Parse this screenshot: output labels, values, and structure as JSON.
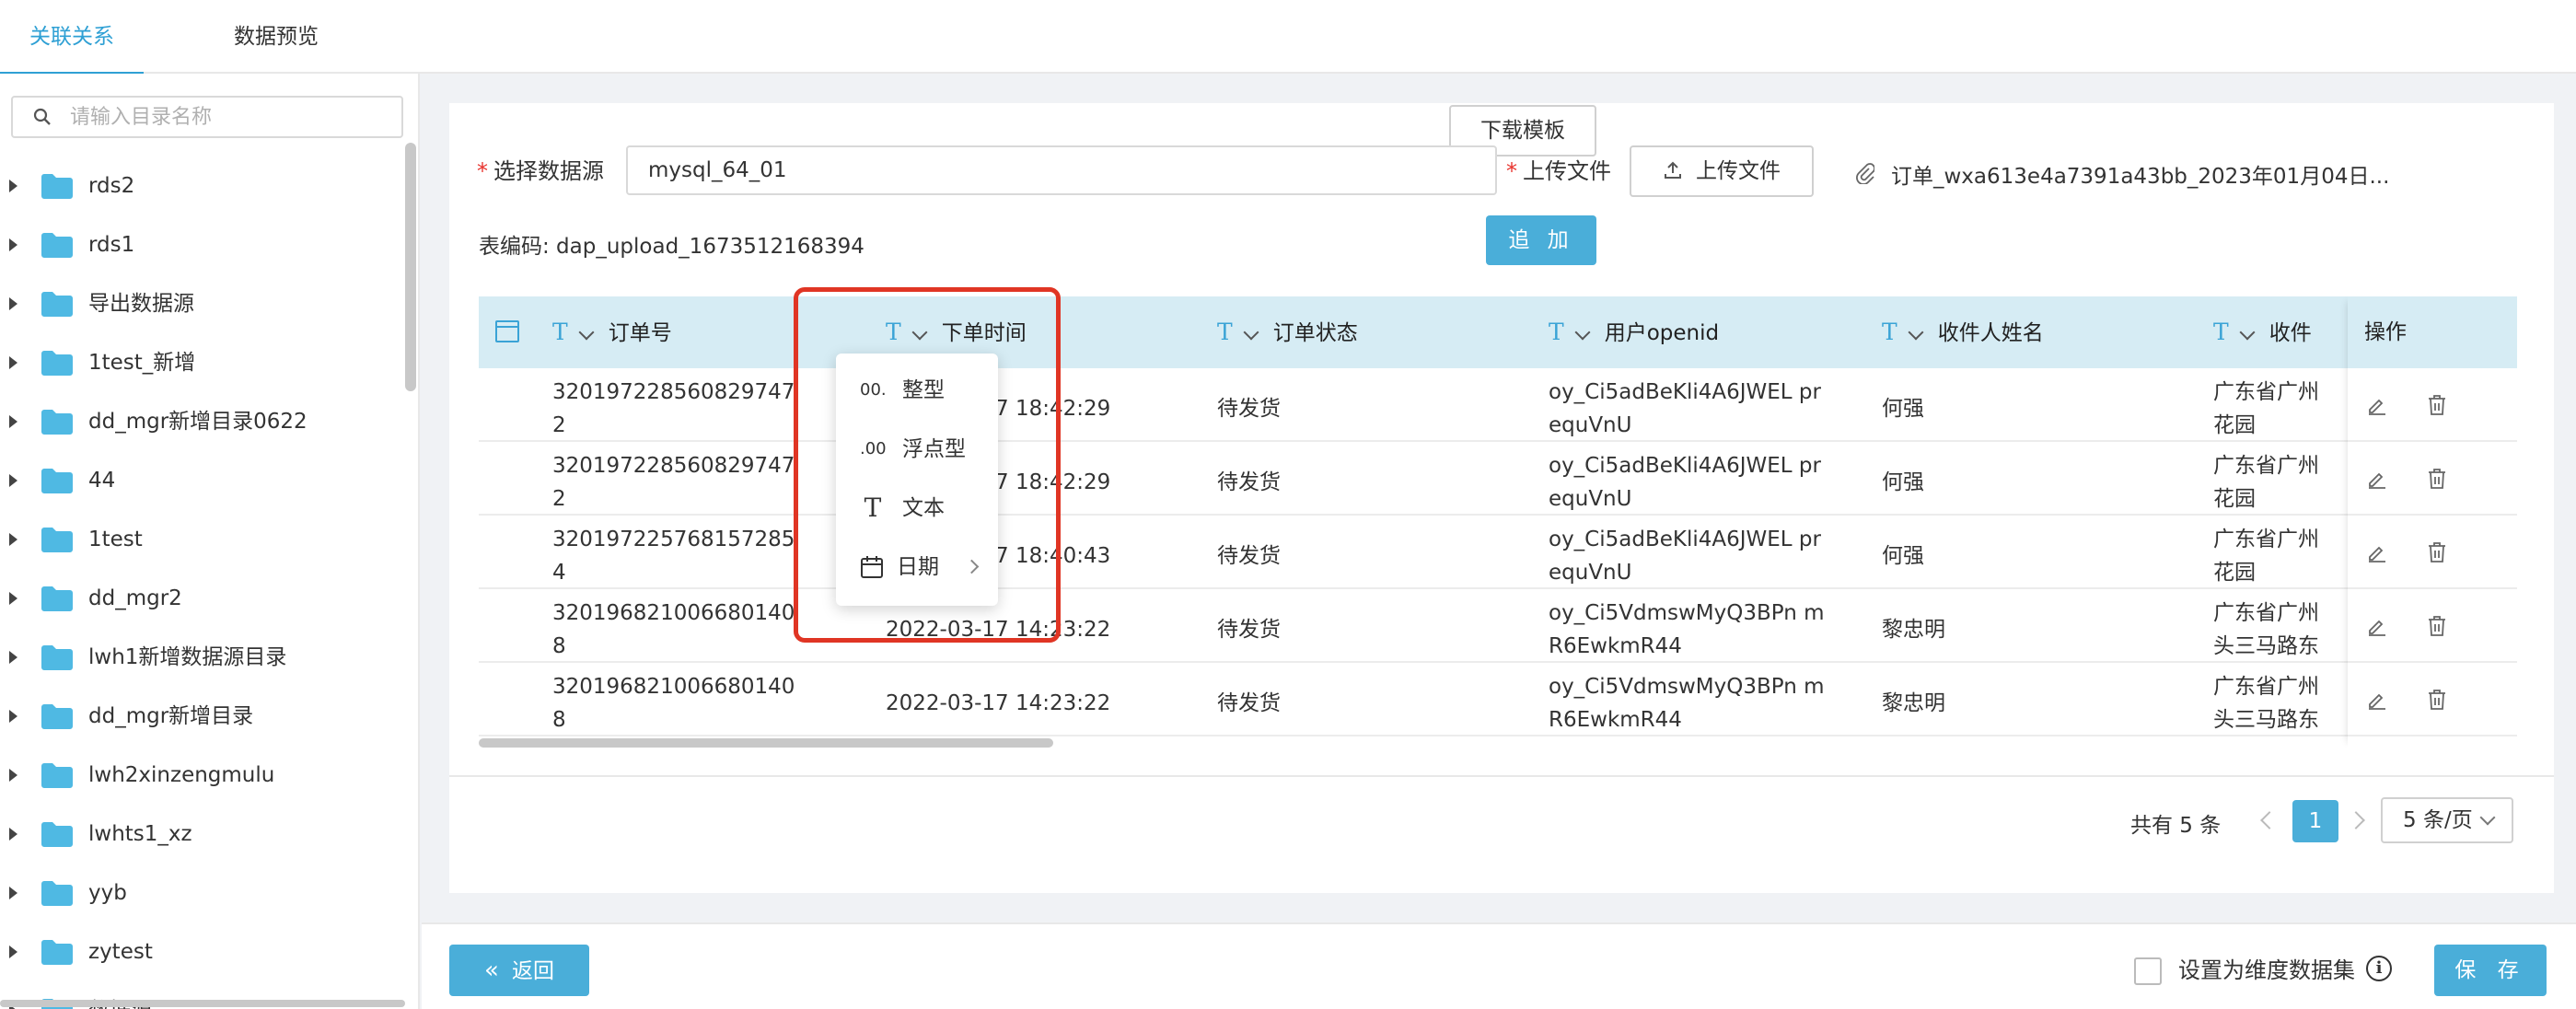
{
  "tabs": [
    {
      "label": "关联关系",
      "active": true
    },
    {
      "label": "数据预览",
      "active": false
    }
  ],
  "sidebar": {
    "search_placeholder": "请输入目录名称",
    "items": [
      {
        "label": "rds2"
      },
      {
        "label": "rds1"
      },
      {
        "label": "导出数据源"
      },
      {
        "label": "1test_新增"
      },
      {
        "label": "dd_mgr新增目录0622"
      },
      {
        "label": "44"
      },
      {
        "label": "1test"
      },
      {
        "label": "dd_mgr2"
      },
      {
        "label": "lwh1新增数据源目录"
      },
      {
        "label": "dd_mgr新增目录"
      },
      {
        "label": "lwh2xinzengmulu"
      },
      {
        "label": "lwhts1_xz"
      },
      {
        "label": "yyb"
      },
      {
        "label": "zytest"
      },
      {
        "label": "数据源"
      }
    ]
  },
  "form": {
    "download_template": "下载模板",
    "datasource_label": "选择数据源",
    "datasource_value": "mysql_64_01",
    "upload_label": "上传文件",
    "upload_button": "上传文件",
    "file_name": "订单_wxa613e4a7391a43bb_2023年01月04日...",
    "add_button": "追 加",
    "table_code": "表编码: dap_upload_1673512168394"
  },
  "table": {
    "type_icon": "T",
    "columns": [
      "订单号",
      "下单时间",
      "订单状态",
      "用户openid",
      "收件人姓名",
      "收件"
    ],
    "ops_header": "操作",
    "rows": [
      [
        "320197228560829747 2",
        "2022-03-17 18:42:29",
        "待发货",
        "oy_Ci5adBeKli4A6JWEL prequVnU",
        "何强",
        "广东省广州 花园"
      ],
      [
        "320197228560829747 2",
        "2022-03-17 18:42:29",
        "待发货",
        "oy_Ci5adBeKli4A6JWEL prequVnU",
        "何强",
        "广东省广州 花园"
      ],
      [
        "320197225768157285 4",
        "2022-03-17 18:40:43",
        "待发货",
        "oy_Ci5adBeKli4A6JWEL prequVnU",
        "何强",
        "广东省广州 花园"
      ],
      [
        "320196821006680140 8",
        "2022-03-17 14:23:22",
        "待发货",
        "oy_Ci5VdmswMyQ3BPn mR6EwkmR44",
        "黎忠明",
        "广东省广州 头三马路东"
      ],
      [
        "320196821006680140 8",
        "2022-03-17 14:23:22",
        "待发货",
        "oy_Ci5VdmswMyQ3BPn mR6EwkmR44",
        "黎忠明",
        "广东省广州 头三马路东"
      ]
    ]
  },
  "type_menu": [
    {
      "icon": "00.",
      "label": "整型"
    },
    {
      "icon": ".00",
      "label": "浮点型"
    },
    {
      "icon": "T",
      "label": "文本"
    },
    {
      "icon": "calendar-icon",
      "label": "日期"
    }
  ],
  "pagination": {
    "total": "共有 5 条",
    "current": "1",
    "page_size": "5 条/页"
  },
  "footer": {
    "back": "返回",
    "dimension_label": "设置为维度数据集",
    "save": "保 存"
  },
  "colors": {
    "accent": "#4aaed9",
    "header_bg": "#d6ecf4",
    "highlight": "#e03524",
    "required": "#e8342e"
  }
}
